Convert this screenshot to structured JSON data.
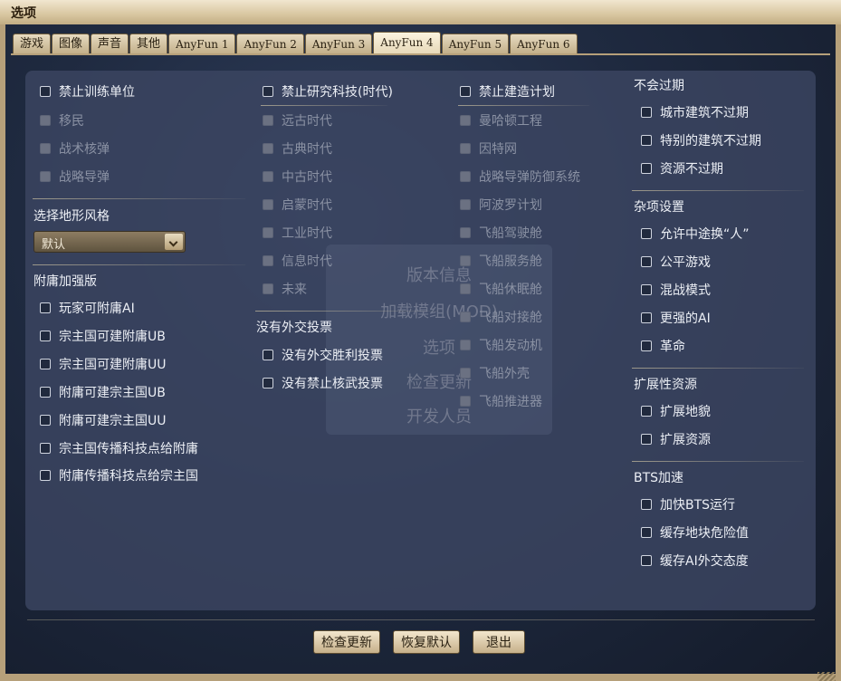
{
  "window": {
    "title": "选项"
  },
  "tabs": [
    "游戏",
    "图像",
    "声音",
    "其他",
    "AnyFun 1",
    "AnyFun 2",
    "AnyFun 3",
    "AnyFun 4",
    "AnyFun 5",
    "AnyFun 6"
  ],
  "active_tab": "AnyFun 4",
  "col1": {
    "top": [
      {
        "label": "禁止训练单位",
        "enabled": true
      },
      {
        "label": "移民",
        "enabled": false
      },
      {
        "label": "战术核弹",
        "enabled": false
      },
      {
        "label": "战略导弹",
        "enabled": false
      }
    ],
    "terrain_heading": "选择地形风格",
    "terrain_value": "默认",
    "vassal_heading": "附庸加强版",
    "vassal": [
      "玩家可附庸AI",
      "宗主国可建附庸UB",
      "宗主国可建附庸UU",
      "附庸可建宗主国UB",
      "附庸可建宗主国UU",
      "宗主国传播科技点给附庸",
      "附庸传播科技点给宗主国"
    ]
  },
  "col2": {
    "tech": [
      {
        "label": "禁止研究科技(时代)",
        "enabled": true
      },
      {
        "label": "远古时代",
        "enabled": false
      },
      {
        "label": "古典时代",
        "enabled": false
      },
      {
        "label": "中古时代",
        "enabled": false
      },
      {
        "label": "启蒙时代",
        "enabled": false
      },
      {
        "label": "工业时代",
        "enabled": false
      },
      {
        "label": "信息时代",
        "enabled": false
      },
      {
        "label": "未来",
        "enabled": false
      }
    ],
    "diplo_heading": "没有外交投票",
    "diplo": [
      "没有外交胜利投票",
      "没有禁止核武投票"
    ]
  },
  "col3": {
    "projects": [
      {
        "label": "禁止建造计划",
        "enabled": true
      },
      {
        "label": "曼哈顿工程",
        "enabled": false
      },
      {
        "label": "因特网",
        "enabled": false
      },
      {
        "label": "战略导弹防御系统",
        "enabled": false
      },
      {
        "label": "阿波罗计划",
        "enabled": false
      },
      {
        "label": "飞船驾驶舱",
        "enabled": false
      },
      {
        "label": "飞船服务舱",
        "enabled": false
      },
      {
        "label": "飞船休眠舱",
        "enabled": false
      },
      {
        "label": "飞船对接舱",
        "enabled": false
      },
      {
        "label": "飞船发动机",
        "enabled": false
      },
      {
        "label": "飞船外壳",
        "enabled": false
      },
      {
        "label": "飞船推进器",
        "enabled": false
      }
    ]
  },
  "col4": {
    "obsolete_heading": "不会过期",
    "obsolete": [
      "城市建筑不过期",
      "特别的建筑不过期",
      "资源不过期"
    ],
    "misc_heading": "杂项设置",
    "misc": [
      "允许中途换“人”",
      "公平游戏",
      "混战模式",
      "更强的AI",
      "革命"
    ],
    "ext_heading": "扩展性资源",
    "ext": [
      "扩展地貌",
      "扩展资源"
    ],
    "bts_heading": "BTS加速",
    "bts": [
      "加快BTS运行",
      "缓存地块危险值",
      "缓存AI外交态度"
    ]
  },
  "ghost_menu": [
    "版本信息",
    "加载模组(MOD)",
    "选项",
    "检查更新",
    "开发人员"
  ],
  "buttons": {
    "check_update": "检查更新",
    "restore_default": "恢复默认",
    "exit": "退出"
  }
}
